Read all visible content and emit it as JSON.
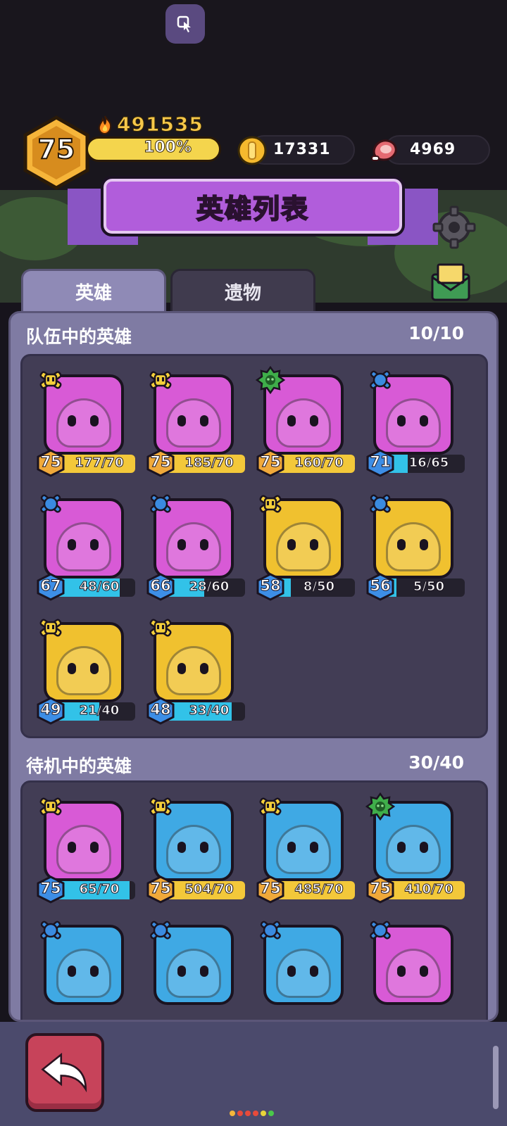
{
  "header": {
    "player_level": "75",
    "power": "491535",
    "xp_percent_text": "100%",
    "xp_fraction": 1.0,
    "coins": "17331",
    "meat": "4969"
  },
  "title": "英雄列表",
  "tabs": [
    {
      "label": "英雄",
      "active": true
    },
    {
      "label": "遗物",
      "active": false
    }
  ],
  "team": {
    "heading": "队伍中的英雄",
    "count": "10/10",
    "heroes": [
      {
        "rank": "gold",
        "level": "75",
        "progress": "177/70",
        "fill": 1.0,
        "bar": "gold",
        "card": "#d85ad6",
        "icon": "goblin-archer-icon"
      },
      {
        "rank": "gold",
        "level": "75",
        "progress": "185/70",
        "fill": 1.0,
        "bar": "gold",
        "card": "#d85ad6",
        "icon": "skull-cap-slime-icon"
      },
      {
        "rank": "green",
        "level": "75",
        "progress": "160/70",
        "fill": 1.0,
        "bar": "gold",
        "card": "#d85ad6",
        "icon": "robot-knight-icon"
      },
      {
        "rank": "blue",
        "level": "71",
        "progress": "16/65",
        "fill": 0.246,
        "bar": "blue",
        "card": "#d85ad6",
        "icon": "mummy-icon"
      },
      {
        "rank": "blue",
        "level": "67",
        "progress": "48/60",
        "fill": 0.8,
        "bar": "blue",
        "card": "#d85ad6",
        "icon": "bunny-icon"
      },
      {
        "rank": "blue",
        "level": "66",
        "progress": "28/60",
        "fill": 0.467,
        "bar": "blue",
        "card": "#d85ad6",
        "icon": "tree-stump-icon"
      },
      {
        "rank": "gold",
        "level": "58",
        "progress": "8/50",
        "fill": 0.16,
        "bar": "blue",
        "card": "#f0c12f",
        "icon": "samurai-icon"
      },
      {
        "rank": "blue",
        "level": "56",
        "progress": "5/50",
        "fill": 0.1,
        "bar": "blue",
        "card": "#f0c12f",
        "icon": "monkey-king-icon"
      },
      {
        "rank": "gold",
        "level": "49",
        "progress": "21/40",
        "fill": 0.525,
        "bar": "blue",
        "card": "#f0c12f",
        "icon": "princess-icon"
      },
      {
        "rank": "gold",
        "level": "48",
        "progress": "33/40",
        "fill": 0.825,
        "bar": "blue",
        "card": "#f0c12f",
        "icon": "fire-warrior-icon"
      }
    ]
  },
  "reserve": {
    "heading": "待机中的英雄",
    "count": "30/40",
    "heroes": [
      {
        "rank": "gold",
        "level": "75",
        "progress": "65/70",
        "fill": 0.929,
        "bar": "blue",
        "card": "#d85ad6",
        "icon": "armored-knight-icon"
      },
      {
        "rank": "gold",
        "level": "75",
        "progress": "504/70",
        "fill": 1.0,
        "bar": "gold",
        "card": "#3fa9e4",
        "icon": "dragon-icon"
      },
      {
        "rank": "gold",
        "level": "75",
        "progress": "485/70",
        "fill": 1.0,
        "bar": "gold",
        "card": "#3fa9e4",
        "icon": "leaf-ninja-icon"
      },
      {
        "rank": "green",
        "level": "75",
        "progress": "410/70",
        "fill": 1.0,
        "bar": "gold",
        "card": "#3fa9e4",
        "icon": "robot-block-icon"
      },
      {
        "rank": "blue",
        "level": "",
        "progress": "",
        "fill": 0,
        "bar": "blue",
        "card": "#3fa9e4",
        "icon": "spike-helmet-slime-icon"
      },
      {
        "rank": "blue",
        "level": "",
        "progress": "",
        "fill": 0,
        "bar": "blue",
        "card": "#3fa9e4",
        "icon": "snowman-icon"
      },
      {
        "rank": "blue",
        "level": "",
        "progress": "",
        "fill": 0,
        "bar": "blue",
        "card": "#3fa9e4",
        "icon": "rock-golem-icon"
      },
      {
        "rank": "blue",
        "level": "",
        "progress": "",
        "fill": 0,
        "bar": "blue",
        "card": "#d85ad6",
        "icon": "shark-icon"
      }
    ]
  },
  "colors": {
    "gold_bar": "#f3c83a",
    "blue_bar": "#32c2e8",
    "rank_gold": "#f4cf3a",
    "rank_green": "#3fae4a",
    "rank_blue": "#3a8be0",
    "level_gold": "#f0a93a",
    "level_blue": "#3d8ee6"
  }
}
